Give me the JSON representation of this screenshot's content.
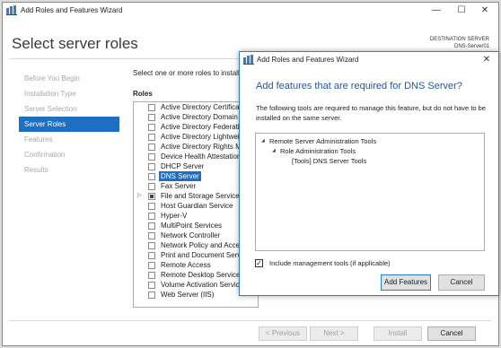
{
  "window": {
    "title": "Add Roles and Features Wizard",
    "minimize_glyph": "—",
    "maximize_glyph": "☐",
    "close_glyph": "✕"
  },
  "page": {
    "title": "Select server roles",
    "destination_label": "DESTINATION SERVER",
    "destination_server": "DNS-Server01",
    "instruction": "Select one or more roles to install",
    "roles_header": "Roles"
  },
  "nav": {
    "items": [
      {
        "label": "Before You Begin",
        "state": "disabled"
      },
      {
        "label": "Installation Type",
        "state": "disabled"
      },
      {
        "label": "Server Selection",
        "state": "disabled"
      },
      {
        "label": "Server Roles",
        "state": "active"
      },
      {
        "label": "Features",
        "state": "disabled"
      },
      {
        "label": "Confirmation",
        "state": "disabled"
      },
      {
        "label": "Results",
        "state": "disabled"
      }
    ]
  },
  "roles": [
    {
      "name": "Active Directory Certificat",
      "checked": false
    },
    {
      "name": "Active Directory Domain",
      "checked": false
    },
    {
      "name": "Active Directory Federatio",
      "checked": false
    },
    {
      "name": "Active Directory Lightwei",
      "checked": false
    },
    {
      "name": "Active Directory Rights M",
      "checked": false
    },
    {
      "name": "Device Health Attestation",
      "checked": false
    },
    {
      "name": "DHCP Server",
      "checked": false
    },
    {
      "name": "DNS Server",
      "checked": false,
      "selected": true
    },
    {
      "name": "Fax Server",
      "checked": false
    },
    {
      "name": "File and Storage Services",
      "checked": "partial",
      "expandable": true
    },
    {
      "name": "Host Guardian Service",
      "checked": false
    },
    {
      "name": "Hyper-V",
      "checked": false
    },
    {
      "name": "MultiPoint Services",
      "checked": false
    },
    {
      "name": "Network Controller",
      "checked": false
    },
    {
      "name": "Network Policy and Acces",
      "checked": false
    },
    {
      "name": "Print and Document Serv",
      "checked": false
    },
    {
      "name": "Remote Access",
      "checked": false
    },
    {
      "name": "Remote Desktop Services",
      "checked": false
    },
    {
      "name": "Volume Activation Service",
      "checked": false
    },
    {
      "name": "Web Server (IIS)",
      "checked": false
    }
  ],
  "footer": {
    "previous": "< Previous",
    "next": "Next >",
    "install": "Install",
    "cancel": "Cancel"
  },
  "dialog": {
    "title": "Add Roles and Features Wizard",
    "close_glyph": "✕",
    "heading": "Add features that are required for DNS Server?",
    "description": "The following tools are required to manage this feature, but do not have to be installed on the same server.",
    "tree": [
      {
        "label": "Remote Server Administration Tools",
        "level": 0,
        "expanded": true
      },
      {
        "label": "Role Administration Tools",
        "level": 1,
        "expanded": true
      },
      {
        "label": "[Tools] DNS Server Tools",
        "level": 2,
        "expanded": false
      }
    ],
    "include_label": "Include management tools (if applicable)",
    "include_checked": true,
    "include_glyph": "✓",
    "add_button": "Add Features",
    "cancel_button": "Cancel"
  },
  "colors": {
    "accent": "#1e6fc4",
    "dialog_heading": "#1e57a8",
    "dialog_border": "#2f7fd0"
  }
}
